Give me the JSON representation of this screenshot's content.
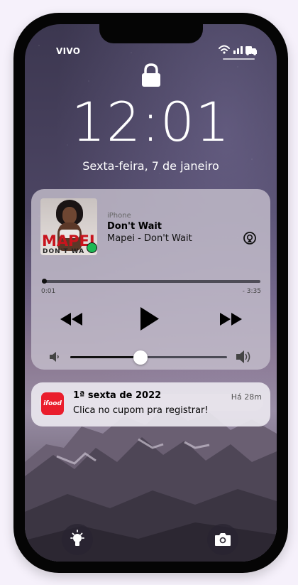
{
  "status_bar": {
    "carrier": "VIVO"
  },
  "lock_screen": {
    "time": "12:01",
    "date": "Sexta-feira, 7 de janeiro"
  },
  "player": {
    "source": "iPhone",
    "title": "Don't Wait",
    "artist_line": "Mapei - Don't Wait",
    "album_art_text": "MAPEI",
    "album_art_subtext": "DON'T WA",
    "elapsed": "0:01",
    "remaining": "- 3:35",
    "progress_fraction": 0.005,
    "volume_fraction": 0.45
  },
  "notification": {
    "app_logo_text": "ifood",
    "title": "1ª sexta de 2022",
    "body": "Clica no cupom pra registrar!",
    "age": "Há 28m",
    "accent_color": "#ea1d2c"
  },
  "icons": [
    "lock-icon",
    "wifi-icon",
    "signal-icon",
    "battery-icon",
    "airplay-icon",
    "rewind-icon",
    "play-icon",
    "fast-forward-icon",
    "volume-low-icon",
    "volume-high-icon",
    "flashlight-icon",
    "camera-icon"
  ]
}
